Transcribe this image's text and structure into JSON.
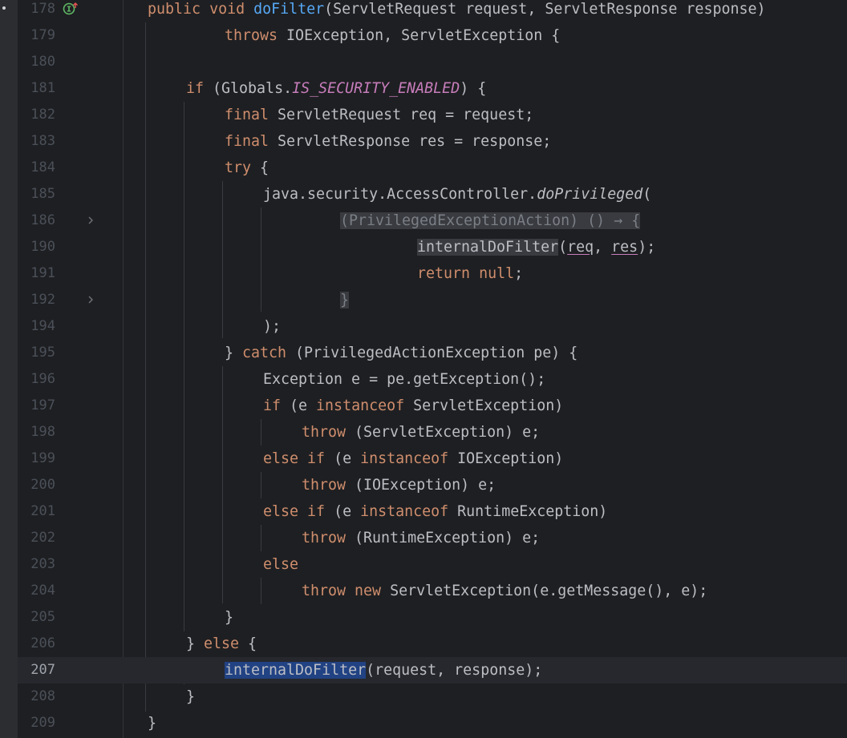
{
  "editor": {
    "current_line": "207",
    "lines": [
      {
        "num": "178",
        "text": "public void doFilter(ServletRequest request, ServletResponse response)"
      },
      {
        "num": "179",
        "text": "throws IOException, ServletException {"
      },
      {
        "num": "180",
        "text": ""
      },
      {
        "num": "181",
        "text": "if (Globals.IS_SECURITY_ENABLED) {"
      },
      {
        "num": "182",
        "text": "final ServletRequest req = request;"
      },
      {
        "num": "183",
        "text": "final ServletResponse res = response;"
      },
      {
        "num": "184",
        "text": "try {"
      },
      {
        "num": "185",
        "text": "java.security.AccessController.doPrivileged("
      },
      {
        "num": "186",
        "text": "(PrivilegedExceptionAction) () → {"
      },
      {
        "num": "190",
        "text": "internalDoFilter(req, res);"
      },
      {
        "num": "191",
        "text": "return null;"
      },
      {
        "num": "192",
        "text": "}"
      },
      {
        "num": "194",
        "text": ");"
      },
      {
        "num": "195",
        "text": "} catch (PrivilegedActionException pe) {"
      },
      {
        "num": "196",
        "text": "Exception e = pe.getException();"
      },
      {
        "num": "197",
        "text": "if (e instanceof ServletException)"
      },
      {
        "num": "198",
        "text": "throw (ServletException) e;"
      },
      {
        "num": "199",
        "text": "else if (e instanceof IOException)"
      },
      {
        "num": "200",
        "text": "throw (IOException) e;"
      },
      {
        "num": "201",
        "text": "else if (e instanceof RuntimeException)"
      },
      {
        "num": "202",
        "text": "throw (RuntimeException) e;"
      },
      {
        "num": "203",
        "text": "else"
      },
      {
        "num": "204",
        "text": "throw new ServletException(e.getMessage(), e);"
      },
      {
        "num": "205",
        "text": "}"
      },
      {
        "num": "206",
        "text": "} else {"
      },
      {
        "num": "207",
        "text": "internalDoFilter(request, response);"
      },
      {
        "num": "208",
        "text": "}"
      },
      {
        "num": "209",
        "text": "}"
      }
    ]
  },
  "tokens": {
    "t0_public": "public",
    "t0_void": "void",
    "t0_dofilter": "doFilter",
    "t0_params": "(ServletRequest request, ServletResponse response)",
    "t1_throws": "throws",
    "t1_rest": " IOException, ServletException {",
    "t3_if": "if",
    "t3_open": " (Globals.",
    "t3_const": "IS_SECURITY_ENABLED",
    "t3_close": ") {",
    "t4_final": "final",
    "t4_rest": " ServletRequest req = request;",
    "t5_final": "final",
    "t5_rest": " ServletResponse res = response;",
    "t6_try": "try",
    "t6_rest": " {",
    "t7_pkg": "java.security.AccessController.",
    "t7_method": "doPrivileged",
    "t7_paren": "(",
    "t8_lambda": "(PrivilegedExceptionAction) () → {",
    "t9_call": "internalDoFilter",
    "t9_open": "(",
    "t9_req": "req",
    "t9_comma": ", ",
    "t9_res": "res",
    "t9_close": ");",
    "t10_return": "return",
    "t10_null": "null",
    "t10_semi": ";",
    "t11_brace": "}",
    "t12_close": ");",
    "t13_brace": "} ",
    "t13_catch": "catch",
    "t13_rest": " (PrivilegedActionException pe) {",
    "t14_rest": "Exception e = pe.getException();",
    "t15_if": "if",
    "t15_open": " (e ",
    "t15_instanceof": "instanceof",
    "t15_rest": " ServletException)",
    "t16_throw": "throw",
    "t16_rest": " (ServletException) e;",
    "t17_else": "else",
    "t17_if": "if",
    "t17_open": " (e ",
    "t17_instanceof": "instanceof",
    "t17_rest": " IOException)",
    "t18_throw": "throw",
    "t18_rest": " (IOException) e;",
    "t19_else": "else",
    "t19_if": "if",
    "t19_open": " (e ",
    "t19_instanceof": "instanceof",
    "t19_rest": " RuntimeException)",
    "t20_throw": "throw",
    "t20_rest": " (RuntimeException) e;",
    "t21_else": "else",
    "t22_throw": "throw",
    "t22_new": "new",
    "t22_rest": " ServletException(e.getMessage(), e);",
    "t23_brace": "}",
    "t24_brace": "} ",
    "t24_else": "else",
    "t24_rest": " {",
    "t25_call": "internalDoFilter",
    "t25_rest": "(request, response);",
    "t26_brace": "}",
    "t27_brace": "}"
  },
  "icons": {
    "line_178": "implementing-method-icon",
    "line_186": "fold-chevron-right-icon",
    "line_192": "fold-chevron-right-icon"
  },
  "colors": {
    "background": "#1e1f22",
    "keyword": "#cf8e6d",
    "function": "#56a8f5",
    "constant": "#c77dbb",
    "text": "#bcbec4",
    "line_number": "#4b5059",
    "selection": "#214283"
  }
}
